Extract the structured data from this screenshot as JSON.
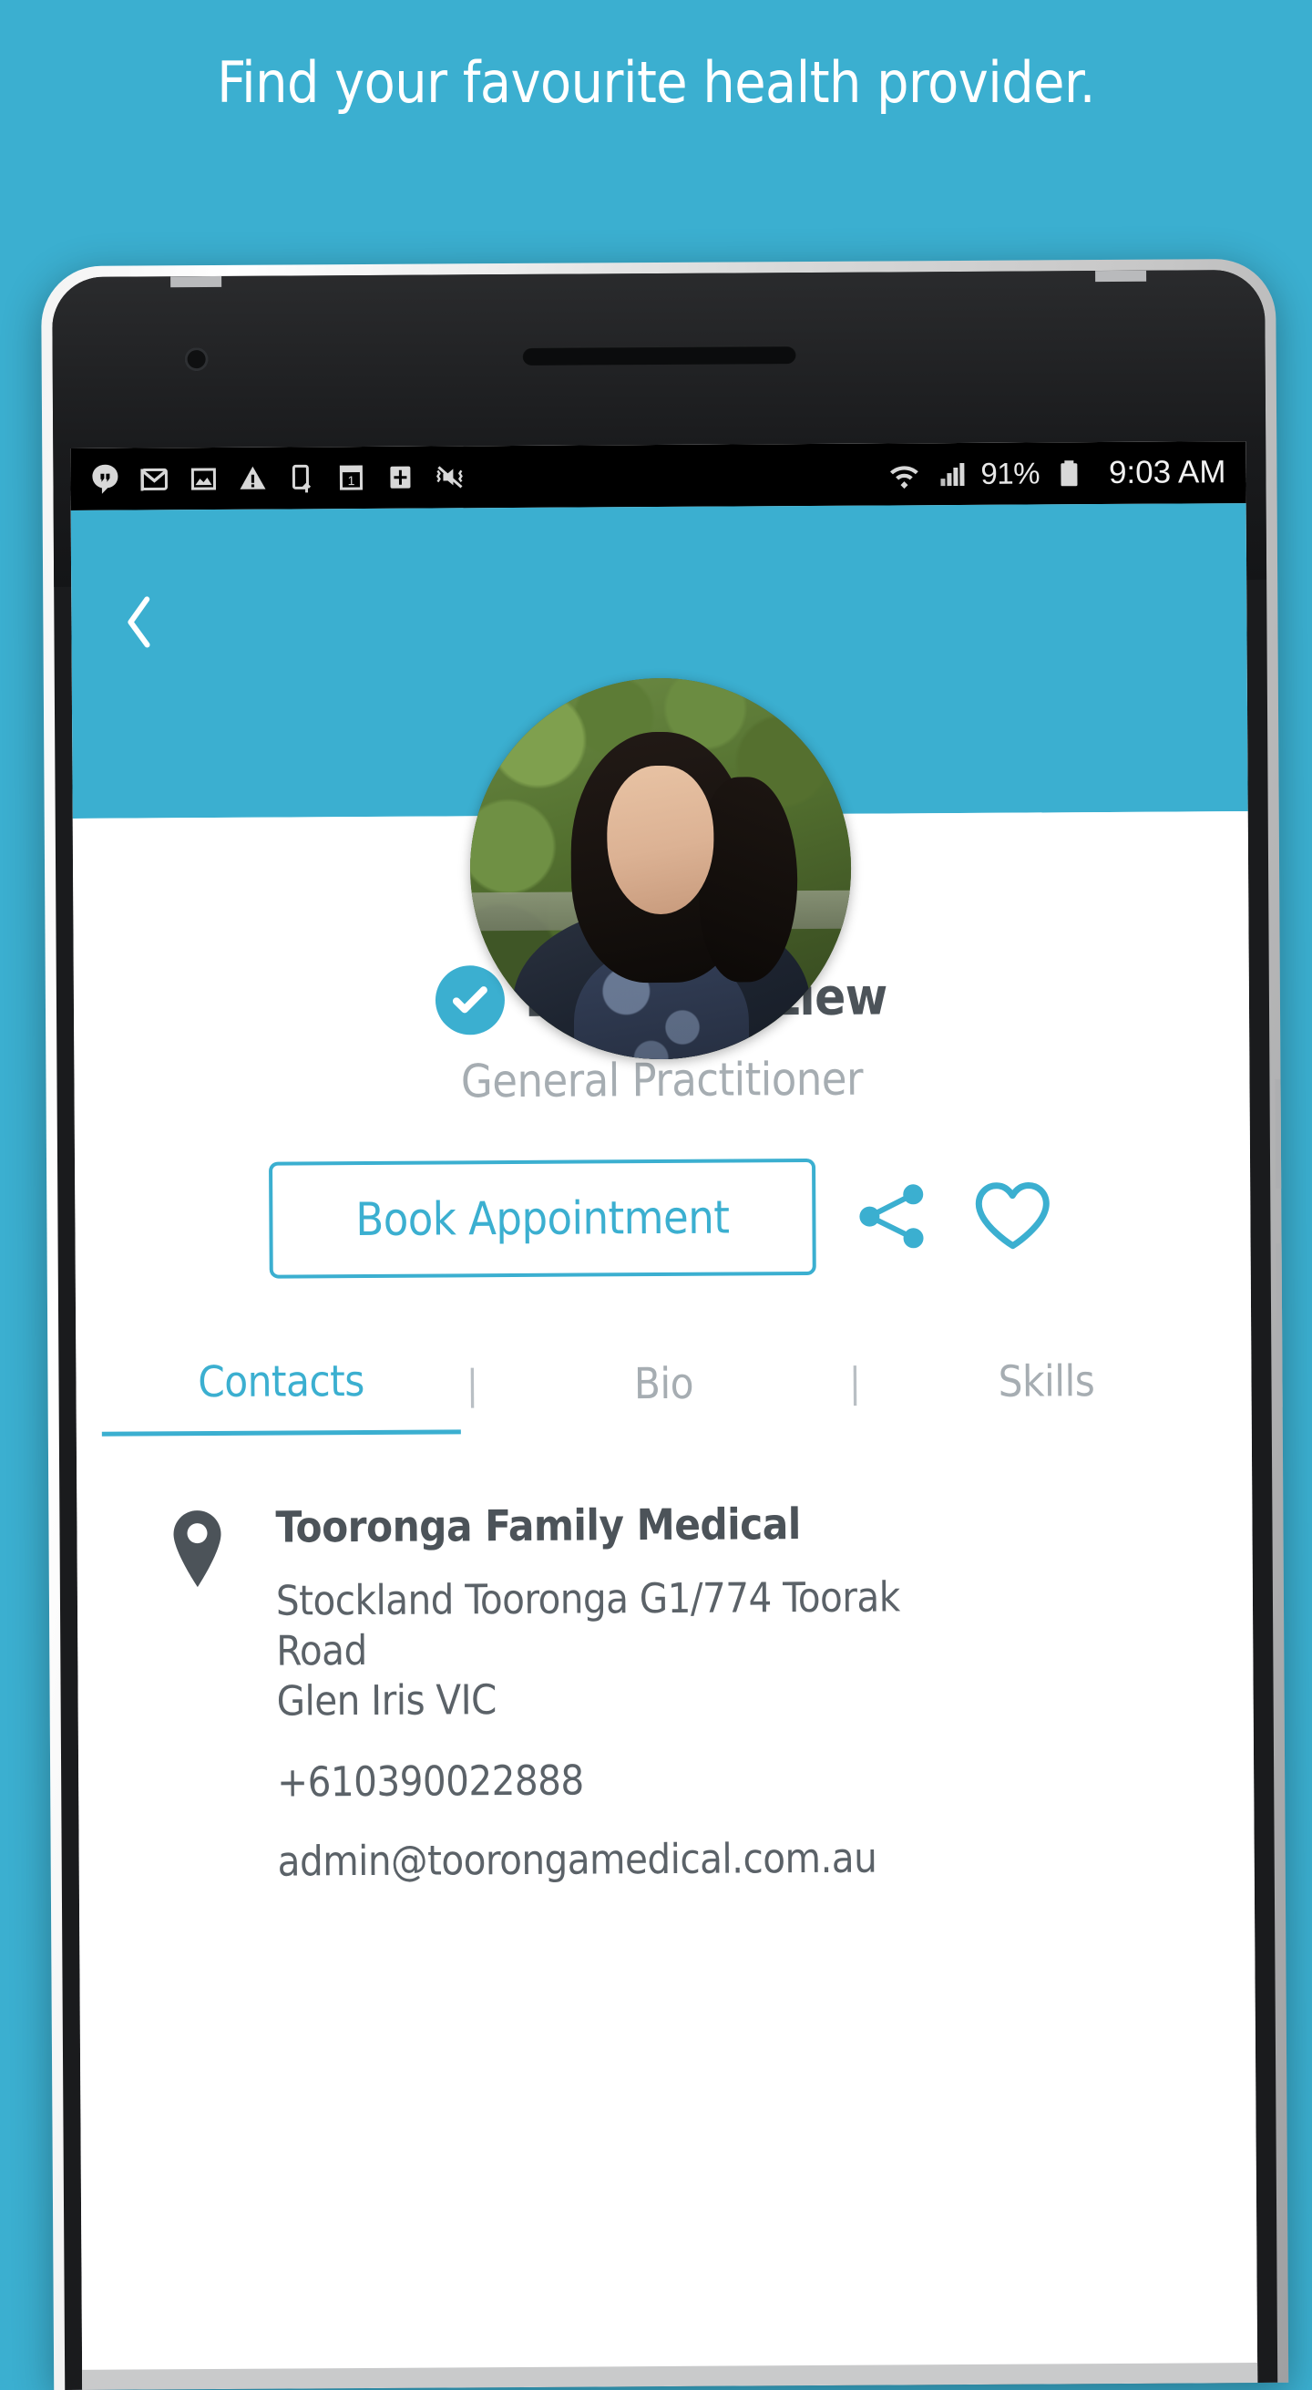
{
  "headline": "Find your favourite health provider.",
  "colors": {
    "brand_teal": "#3bafd0",
    "text_dark": "#4c5359",
    "text_muted": "#a6adb2",
    "body_text": "#5b6268"
  },
  "status_bar": {
    "icons": [
      "hangouts-icon",
      "gmail-icon",
      "photo-icon",
      "warning-icon",
      "phone-upload-icon",
      "calendar-icon",
      "cross-icon",
      "vibrate-mute-icon"
    ],
    "calendar_day": "1",
    "wifi": "wifi-icon",
    "signal": "signal-bars-icon",
    "battery_percent": "91%",
    "battery": "battery-icon",
    "time": "9:03 AM"
  },
  "app_header": {
    "back": "back-arrow-icon",
    "avatar": "doctor-avatar"
  },
  "profile": {
    "verified_badge": "check-icon",
    "name": "Dr Elaine Liew",
    "title": "General Practitioner"
  },
  "actions": {
    "book_label": "Book Appointment",
    "share": "share-icon",
    "favourite": "heart-icon"
  },
  "tabs": [
    {
      "label": "Contacts",
      "active": true
    },
    {
      "label": "Bio",
      "active": false
    },
    {
      "label": "Skills",
      "active": false
    }
  ],
  "tab_separator": "|",
  "contact": {
    "pin": "location-pin-icon",
    "clinic": "Tooronga Family Medical",
    "address_line1": "Stockland Tooronga G1/774 Toorak Road",
    "address_line2": "Glen Iris VIC",
    "phone": "+610390022888",
    "email": "admin@toorongamedical.com.au"
  }
}
